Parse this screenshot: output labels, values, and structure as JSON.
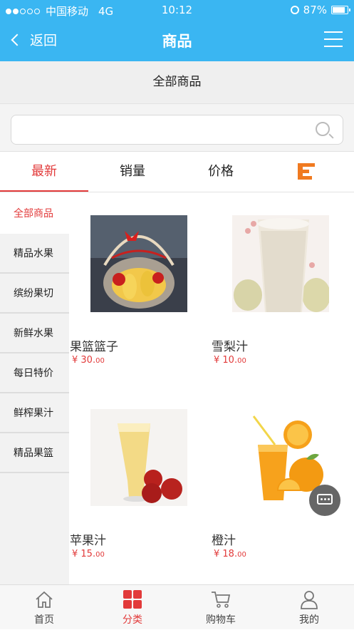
{
  "status_bar": {
    "carrier": "中国移动",
    "network": "4G",
    "time": "10:12",
    "battery": "87%",
    "battery_level": 0.87
  },
  "nav": {
    "back_label": "返回",
    "title": "商品"
  },
  "category_header": "全部商品",
  "search": {
    "value": "",
    "placeholder": ""
  },
  "sort_tabs": [
    {
      "label": "最新",
      "active": true
    },
    {
      "label": "销量",
      "active": false
    },
    {
      "label": "价格",
      "active": false
    }
  ],
  "sidebar": {
    "items": [
      {
        "label": "全部商品",
        "active": true
      },
      {
        "label": "精品水果"
      },
      {
        "label": "缤纷果切"
      },
      {
        "label": "新鲜水果"
      },
      {
        "label": "每日特价"
      },
      {
        "label": "鲜榨果汁"
      },
      {
        "label": "精品果篮"
      }
    ]
  },
  "products": [
    {
      "name": "果篮篮子",
      "price_main": "¥ 30.",
      "price_cents": "00",
      "image": "fruit-basket"
    },
    {
      "name": "雪梨汁",
      "price_main": "¥ 10.",
      "price_cents": "00",
      "image": "pear-juice"
    },
    {
      "name": "苹果汁",
      "price_main": "¥ 15.",
      "price_cents": "00",
      "image": "apple-juice"
    },
    {
      "name": "橙汁",
      "price_main": "¥ 18.",
      "price_cents": "00",
      "image": "orange-juice"
    }
  ],
  "tabbar": {
    "items": [
      {
        "label": "首页",
        "icon": "home-icon"
      },
      {
        "label": "分类",
        "icon": "category-icon",
        "active": true
      },
      {
        "label": "购物车",
        "icon": "cart-icon"
      },
      {
        "label": "我的",
        "icon": "user-icon"
      }
    ]
  },
  "colors": {
    "primary": "#3ab6f2",
    "accent_red": "#e23a3a",
    "filter_orange": "#f07a20"
  }
}
